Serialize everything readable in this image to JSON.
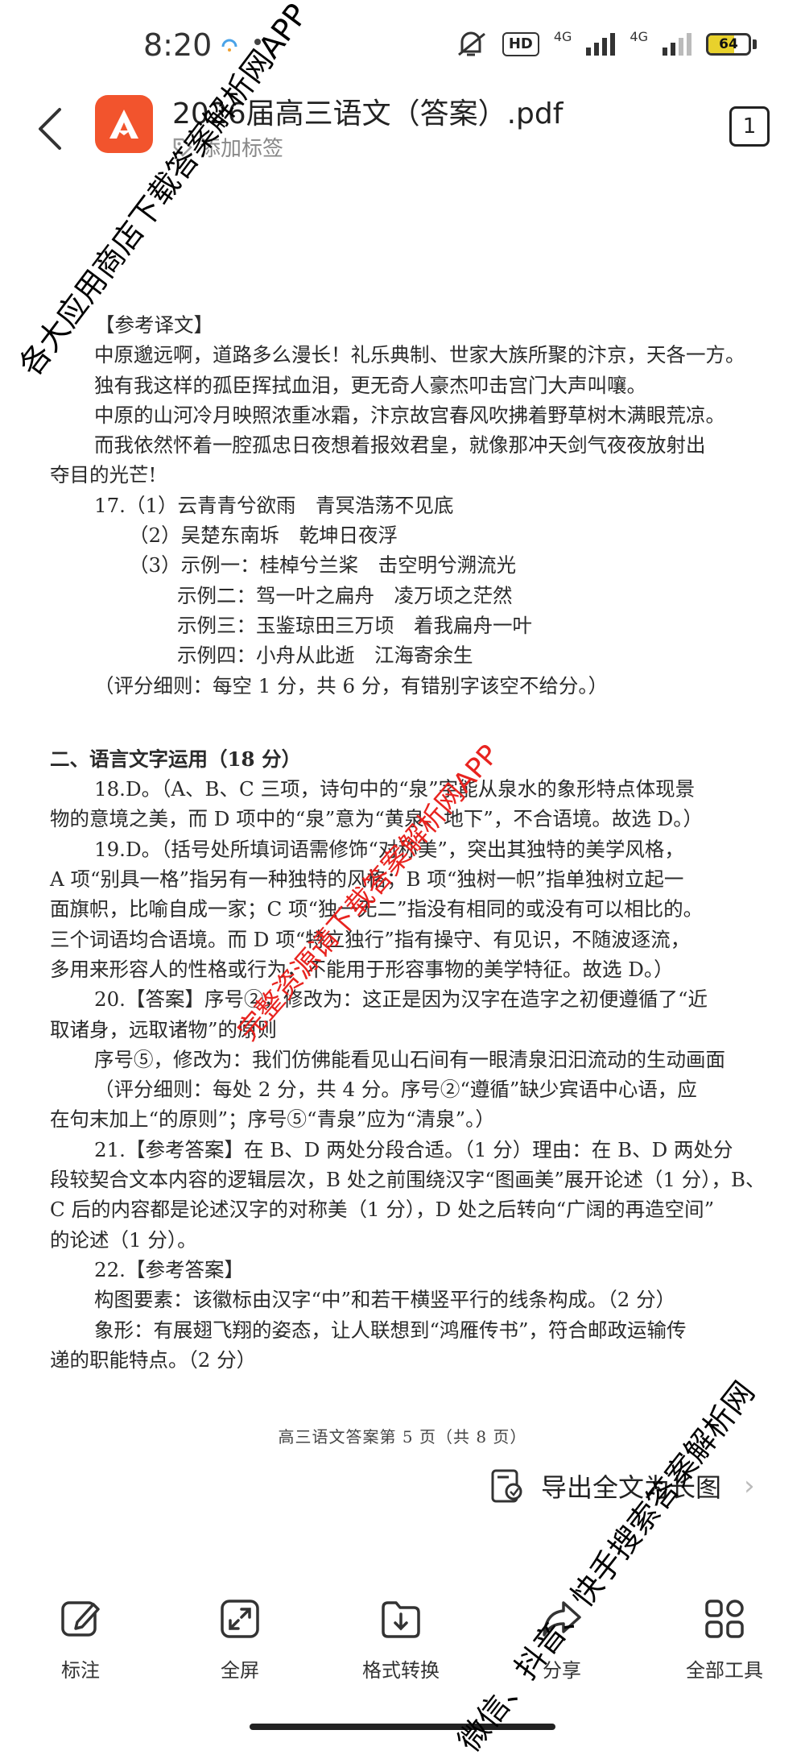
{
  "status_bar": {
    "time": "8:20",
    "hd_label": "HD",
    "network_1": "4G",
    "network_2": "4G",
    "battery_level": 64,
    "battery_text": "64"
  },
  "header": {
    "title": "2026届高三语文（答案）.pdf",
    "tag_label": "添加标签",
    "page_count": "1"
  },
  "document": {
    "translation_heading": "【参考译文】",
    "translation": [
      "中原邈远啊，道路多么漫长！礼乐典制、世家大族所聚的汴京，天各一方。",
      "独有我这样的孤臣挥拭血泪，更无奇人豪杰叩击宫门大声叫嚷。",
      "中原的山河冷月映照浓重冰霜，汴京故宫春风吹拂着野草树木满眼荒凉。",
      "而我依然怀着一腔孤忠日夜想着报效君皇，就像那冲天剑气夜夜放射出",
      "夺目的光芒!"
    ],
    "q17": {
      "line1": "17.（1）云青青兮欲雨　青冥浩荡不见底",
      "line2": "（2）吴楚东南坼　乾坤日夜浮",
      "line3": "（3）示例一：桂棹兮兰桨　击空明兮溯流光",
      "line4": "示例二：驾一叶之扁舟　凌万顷之茫然",
      "line5": "示例三：玉鉴琼田三万顷　着我扁舟一叶",
      "line6": "示例四：小舟从此逝　江海寄余生",
      "scoring": "（评分细则：每空 1 分，共 6 分，有错别字该空不给分。）"
    },
    "section2_heading": "二、语言文字运用（18 分）",
    "q18": [
      "18.D。（A、B、C 三项，诗句中的“泉”字能从泉水的象形特点体现景",
      "物的意境之美，而 D 项中的“泉”意为“黄泉、地下”，不合语境。故选 D。）"
    ],
    "q19": [
      "19.D。（括号处所填词语需修饰“对称美”，突出其独特的美学风格，",
      "A 项“别具一格”指另有一种独特的风格；B 项“独树一帜”指单独树立起一",
      "面旗帜，比喻自成一家；C 项“独一无二”指没有相同的或没有可以相比的。",
      "三个词语均合语境。而 D 项“特立独行”指有操守、有见识，不随波逐流，",
      "多用来形容人的性格或行为，不能用于形容事物的美学特征。故选 D。）"
    ],
    "q20": [
      "20.【答案】序号②，修改为：这正是因为汉字在造字之初便遵循了“近",
      "取诸身，远取诸物”的原则",
      "序号⑤，修改为：我们仿佛能看见山石间有一眼清泉汩汩流动的生动画面",
      "（评分细则：每处 2 分，共 4 分。序号②“遵循”缺少宾语中心语，应",
      "在句末加上“的原则”；序号⑤“青泉”应为“清泉”。）"
    ],
    "q21": [
      "21.【参考答案】在 B、D 两处分段合适。（1 分）理由：在 B、D 两处分",
      "段较契合文本内容的逻辑层次，B 处之前围绕汉字“图画美”展开论述（1 分），B、",
      "C 后的内容都是论述汉字的对称美（1 分），D 处之后转向“广阔的再造空间”",
      "的论述（1 分）。"
    ],
    "q22": [
      "22.【参考答案】",
      "构图要素：该徽标由汉字“中”和若干横竖平行的线条构成。（2 分）",
      "象形：有展翅飞翔的姿态，让人联想到“鸿雁传书”，符合邮政运输传",
      "递的职能特点。（2 分）"
    ],
    "page_footer": "高三语文答案第 5 页（共 8 页）"
  },
  "export_link": "导出全文为长图",
  "toolbar": {
    "items": [
      {
        "label": "标注",
        "icon": "annotate-icon"
      },
      {
        "label": "全屏",
        "icon": "fullscreen-icon"
      },
      {
        "label": "格式转换",
        "icon": "format-convert-icon"
      },
      {
        "label": "分享",
        "icon": "share-icon"
      },
      {
        "label": "全部工具",
        "icon": "all-tools-icon"
      }
    ]
  },
  "watermarks": {
    "top_black": "各大应用商店下载答案解析网APP",
    "middle_red": "完整资源请下载答案解析网APP",
    "bottom_black": "微信、抖音、快手搜索答案解析网"
  },
  "colors": {
    "app_icon": "#f2542d",
    "battery_fill": "#e8d12c",
    "watermark_red": "#e8231f"
  }
}
